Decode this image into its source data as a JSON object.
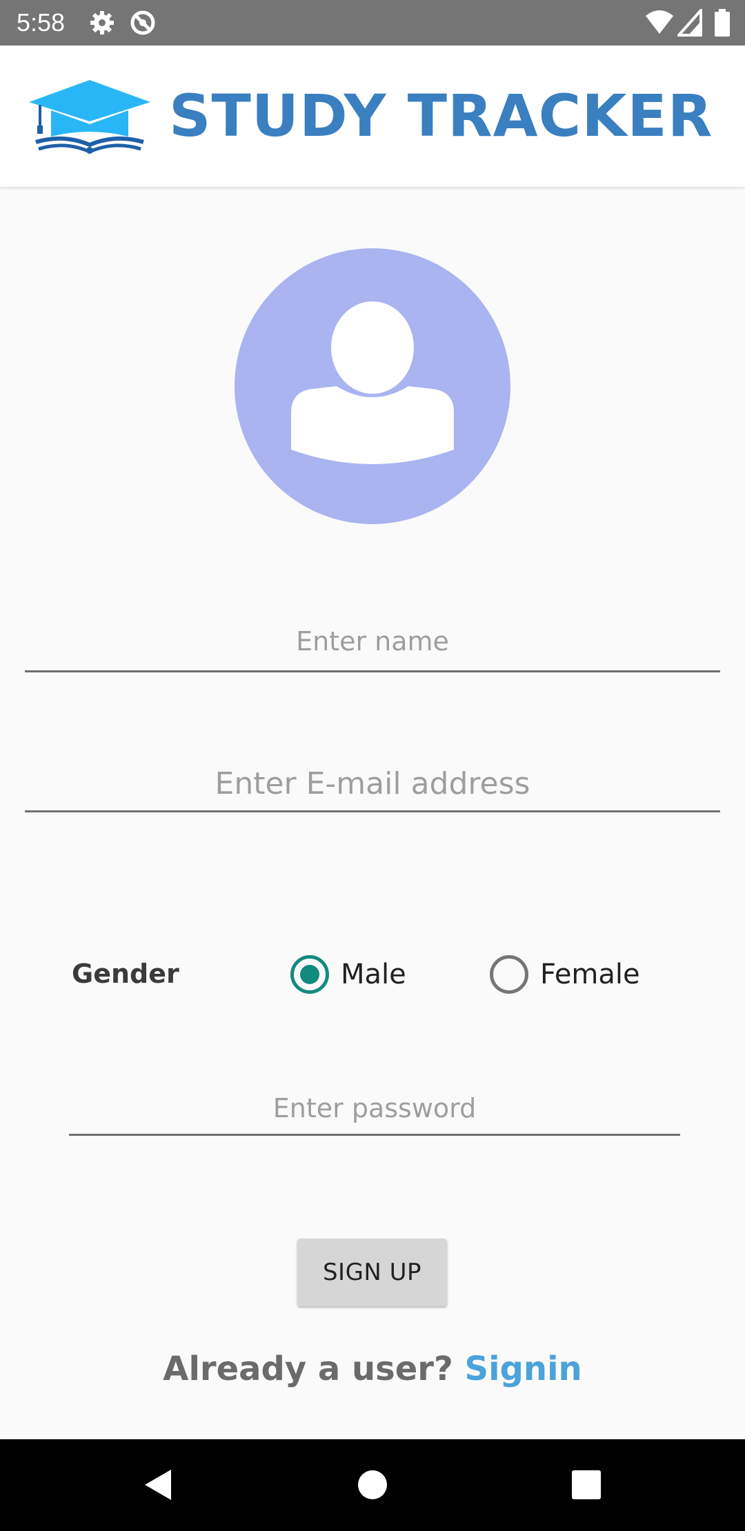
{
  "status_bar": {
    "time": "5:58",
    "icons": [
      "settings-icon",
      "sync-icon",
      "wifi-icon",
      "signal-icon",
      "battery-icon"
    ]
  },
  "header": {
    "logo_text": "STUDY TRACKER",
    "logo_icon": "graduation-cap-book-icon",
    "colors": {
      "cap": "#29b6f6",
      "text": "#3a7fc0"
    }
  },
  "avatar": {
    "icon": "person-silhouette-icon",
    "color": "#a9b4f0"
  },
  "form": {
    "name_placeholder": "Enter name",
    "email_placeholder": "Enter E-mail address",
    "gender_label": "Gender",
    "gender_options": [
      {
        "label": "Male",
        "checked": true
      },
      {
        "label": "Female",
        "checked": false
      }
    ],
    "password_placeholder": "Enter password",
    "signup_label": "SIGN UP",
    "signin_prompt": "Already a user?",
    "signin_link": "Signin",
    "accent_color": "#138a7e",
    "link_color": "#4aa3d9"
  },
  "nav_bar": {
    "buttons": [
      "back-icon",
      "home-icon",
      "recents-icon"
    ]
  }
}
